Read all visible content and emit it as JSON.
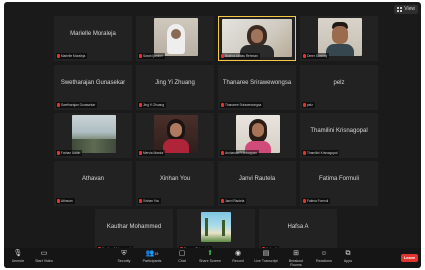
{
  "view_button": {
    "label": "View"
  },
  "participants": [
    {
      "name": "Marielle Moraleja",
      "label": "Marielle Moraleja",
      "has_video": false
    },
    {
      "name": "Sarah Ijambel",
      "label": "Sarah Ijambel",
      "has_video": true
    },
    {
      "name": "Bushra Abbas Rehman",
      "label": "Bushra Abbas Rehman",
      "has_video": true,
      "speaking": true
    },
    {
      "name": "Omer Saadaq",
      "label": "Omer Saadaq",
      "has_video": true
    },
    {
      "name": "Swetharajan Gunasekar",
      "label": "Swetharajan Gunasekar",
      "has_video": false
    },
    {
      "name": "Jing Yi Zhuang",
      "label": "Jing Yi Zhuang",
      "has_video": false
    },
    {
      "name": "Thanaree Srirawewongsa",
      "label": "Thanaree Srirawewongsa",
      "has_video": false
    },
    {
      "name": "pelz",
      "label": "pelz",
      "has_video": false
    },
    {
      "name": "Farhan Uddin",
      "label": "Farhan Uddin",
      "has_video": true
    },
    {
      "name": "Mervia Marcia",
      "label": "Mervia Marcia",
      "has_video": true
    },
    {
      "name": "Archanaa R Arivappan",
      "label": "Archanaa R Arivappan",
      "has_video": true
    },
    {
      "name": "Thamilini Krisnagopal",
      "label": "Thamilini Krisnagopal",
      "has_video": false
    },
    {
      "name": "Athavan",
      "label": "Athavan",
      "has_video": false
    },
    {
      "name": "Xinhan You",
      "label": "Xinhan You",
      "has_video": false
    },
    {
      "name": "Janvi Rautela",
      "label": "Janvi Rautela",
      "has_video": false
    },
    {
      "name": "Fatima Formuli",
      "label": "Fatima Formuli",
      "has_video": false
    },
    {
      "name": "Kauthar Mohammed",
      "label": "Kauthar Mohammed",
      "has_video": false
    },
    {
      "name": "Saaron Chinnaiah",
      "label": "Saaron Chinnaiah",
      "has_video": true
    },
    {
      "name": "Hafsa A",
      "label": "Hafsa A",
      "has_video": false
    }
  ],
  "toolbar": {
    "unmute": "Unmute",
    "start_video": "Start Video",
    "security": "Security",
    "participants": "Participants",
    "participants_count": "19",
    "chat": "Chat",
    "share_screen": "Share Screen",
    "record": "Record",
    "live_transcript": "Live Transcript",
    "breakout_rooms": "Breakout Rooms",
    "reactions": "Reactions",
    "apps": "Apps",
    "end": "Leave"
  },
  "colors": {
    "speaking_outline": "#f6c645",
    "share_green": "#3bb04a",
    "end_red": "#e0342f"
  }
}
